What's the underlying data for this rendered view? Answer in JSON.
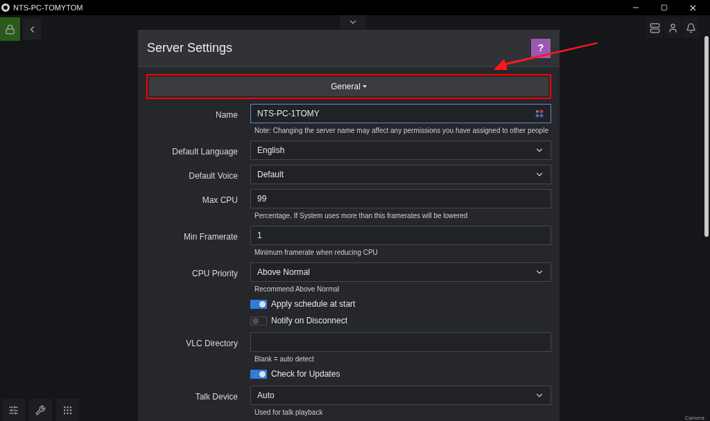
{
  "window": {
    "title": "NTS-PC-TOMYTOM"
  },
  "dialog": {
    "title": "Server Settings",
    "help": "?",
    "section": "General",
    "section_highlighted": true
  },
  "fields": [
    {
      "kind": "text",
      "label": "Name",
      "value": "NTS-PC-1TOMY",
      "focused": true,
      "note": "Note: Changing the server name may affect any permissions you have assigned to other people"
    },
    {
      "kind": "select",
      "label": "Default Language",
      "value": "English"
    },
    {
      "kind": "select",
      "label": "Default Voice",
      "value": "Default"
    },
    {
      "kind": "text",
      "label": "Max CPU",
      "value": "99",
      "focused": false,
      "note": "Percentage. If System uses more than this framerates will be lowered"
    },
    {
      "kind": "text",
      "label": "Min Framerate",
      "value": "1",
      "focused": false,
      "note": "Minimum framerate when reducing CPU"
    },
    {
      "kind": "select",
      "label": "CPU Priority",
      "value": "Above Normal",
      "note": "Recommend Above Normal"
    },
    {
      "kind": "toggle",
      "label": "Apply schedule at start",
      "on": true
    },
    {
      "kind": "toggle",
      "label": "Notify on Disconnect",
      "on": false
    },
    {
      "kind": "text",
      "label": "VLC Directory",
      "focused": false,
      "note": "Blank = auto detect"
    },
    {
      "kind": "toggle",
      "label": "Check for Updates",
      "on": true
    },
    {
      "kind": "select",
      "label": "Talk Device",
      "value": "Auto",
      "note": "Used for talk playback"
    }
  ],
  "corner_label": "Camera"
}
